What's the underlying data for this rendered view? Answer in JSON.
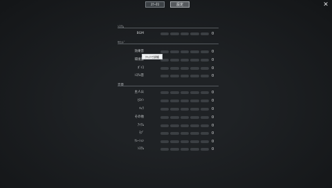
{
  "tabs": [
    {
      "label": "ｽﾃｰﾀｽ"
    },
    {
      "label": "設定"
    }
  ],
  "close_label": "✕",
  "sections": [
    {
      "title": "ｼｽﾃﾑ",
      "rows": [
        {
          "label": "BGM",
          "value": "0"
        }
      ]
    },
    {
      "title": "ｻｳﾝﾄﾞ",
      "rows": [
        {
          "label": "効果音",
          "value": "0"
        },
        {
          "label": "環境音",
          "value": "0"
        },
        {
          "label": "ﾎﾞｲｽ",
          "value": "0"
        },
        {
          "label": "ｼｽﾃﾑ音",
          "value": "0"
        }
      ]
    },
    {
      "title": "音量",
      "rows": [
        {
          "label": "主人公",
          "value": "0"
        },
        {
          "label": "ﾋﾛｲﾝ",
          "value": "0"
        },
        {
          "label": "ｷｬﾗ",
          "value": "0"
        },
        {
          "label": "その他",
          "value": "0"
        },
        {
          "label": "ｱｲﾃﾑ",
          "value": "0"
        },
        {
          "label": "ﾓﾌﾞ",
          "value": "0"
        },
        {
          "label": "ﾅﾚｰｼｮﾝ",
          "value": "0"
        },
        {
          "label": "ｼｽﾃﾑ",
          "value": "0"
        }
      ]
    }
  ],
  "tooltip": "ｸﾘｯｸで詳細"
}
